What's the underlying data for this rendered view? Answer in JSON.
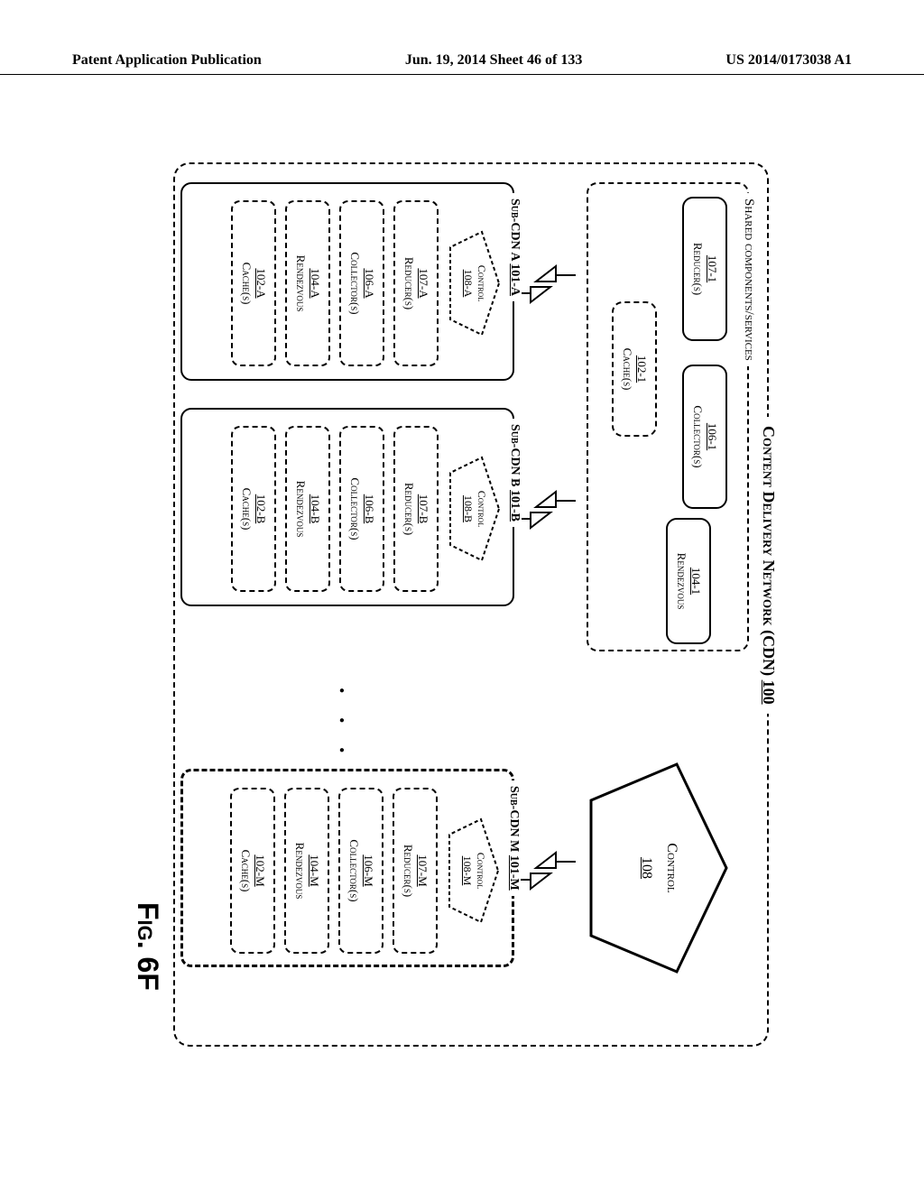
{
  "header": {
    "left": "Patent Application Publication",
    "center": "Jun. 19, 2014  Sheet 46 of 133",
    "right": "US 2014/0173038 A1"
  },
  "cdn": {
    "title": "Content Delivery Network (CDN)",
    "num": "100"
  },
  "shared": {
    "title": "Shared components/services",
    "reducer": {
      "id": "107-1",
      "label": "Reducer(s)"
    },
    "collector": {
      "id": "106-1",
      "label": "Collector(s)"
    },
    "cache": {
      "id": "102-1",
      "label": "Cache(s)"
    },
    "rendezvous": {
      "id": "104-1",
      "label": "Rendezvous"
    }
  },
  "control": {
    "label": "Control",
    "id": "108"
  },
  "subcdns": [
    {
      "title": "Sub-CDN A",
      "num": "101-A",
      "control": {
        "label": "Control",
        "id": "108-A"
      },
      "reducer": {
        "id": "107-A",
        "label": "Reducer(s)"
      },
      "collector": {
        "id": "106-A",
        "label": "Collector(s)"
      },
      "rendezvous": {
        "id": "104-A",
        "label": "Rendezvous"
      },
      "cache": {
        "id": "102-A",
        "label": "Cache(s)"
      }
    },
    {
      "title": "Sub-CDN B",
      "num": "101-B",
      "control": {
        "label": "Control",
        "id": "108-B"
      },
      "reducer": {
        "id": "107-B",
        "label": "Reducer(s)"
      },
      "collector": {
        "id": "106-B",
        "label": "Collector(s)"
      },
      "rendezvous": {
        "id": "104-B",
        "label": "Rendezvous"
      },
      "cache": {
        "id": "102-B",
        "label": "Cache(s)"
      }
    },
    {
      "title": "Sub-CDN M",
      "num": "101-M",
      "control": {
        "label": "Control",
        "id": "108-M"
      },
      "reducer": {
        "id": "107-M",
        "label": "Reducer(s)"
      },
      "collector": {
        "id": "106-M",
        "label": "Collector(s)"
      },
      "rendezvous": {
        "id": "104-M",
        "label": "Rendezvous"
      },
      "cache": {
        "id": "102-M",
        "label": "Cache(s)"
      }
    }
  ],
  "ellipsis": ". . .",
  "figure_label": "Fig. 6F"
}
